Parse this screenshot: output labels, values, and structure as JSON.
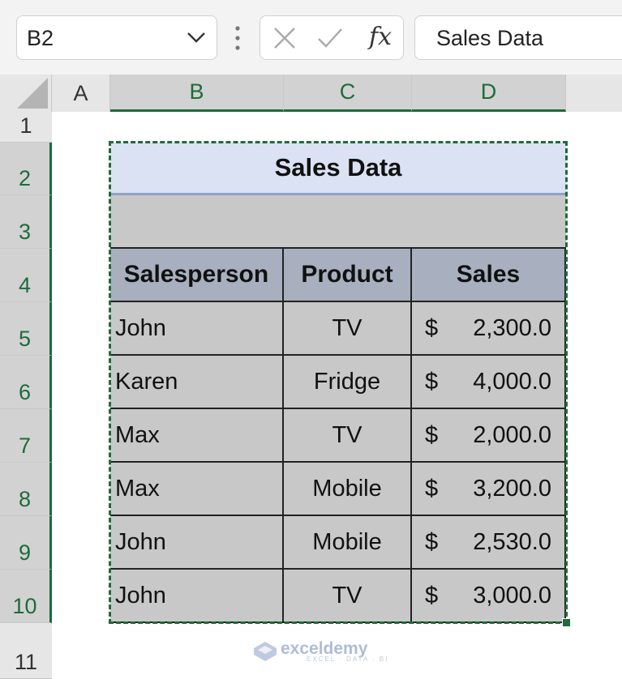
{
  "name_box": {
    "value": "B2"
  },
  "formula_bar": {
    "fx_label": "fx",
    "value": "Sales Data"
  },
  "columns": [
    "A",
    "B",
    "C",
    "D"
  ],
  "rows": [
    "1",
    "2",
    "3",
    "4",
    "5",
    "6",
    "7",
    "8",
    "9",
    "10",
    "11"
  ],
  "sheet": {
    "title": "Sales Data",
    "headers": [
      "Salesperson",
      "Product",
      "Sales"
    ],
    "records": [
      {
        "salesperson": "John",
        "product": "TV",
        "currency": "$",
        "amount": "2,300.0"
      },
      {
        "salesperson": "Karen",
        "product": "Fridge",
        "currency": "$",
        "amount": "4,000.0"
      },
      {
        "salesperson": "Max",
        "product": "TV",
        "currency": "$",
        "amount": "2,000.0"
      },
      {
        "salesperson": "Max",
        "product": "Mobile",
        "currency": "$",
        "amount": "3,200.0"
      },
      {
        "salesperson": "John",
        "product": "Mobile",
        "currency": "$",
        "amount": "2,530.0"
      },
      {
        "salesperson": "John",
        "product": "TV",
        "currency": "$",
        "amount": "3,000.0"
      }
    ]
  },
  "watermark": {
    "brand": "exceldemy",
    "tagline": "EXCEL · DATA · BI"
  },
  "colors": {
    "selection": "#1e6b3a",
    "title_fill": "#dbe2f3",
    "header_fill": "#a8b0bf",
    "body_fill": "#c8c8c8"
  }
}
